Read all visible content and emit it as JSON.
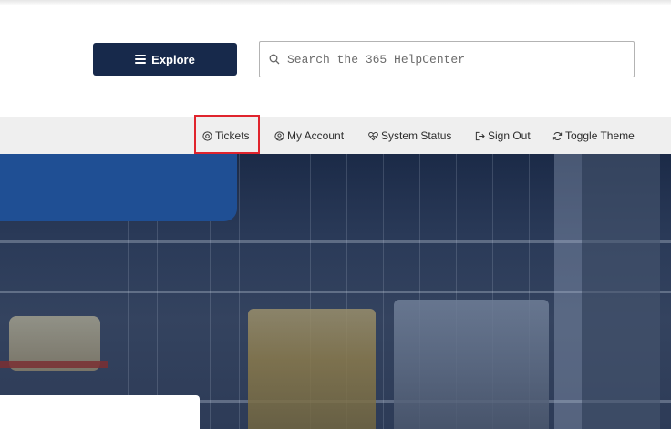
{
  "header": {
    "explore_label": "Explore",
    "search_placeholder": "Search the 365 HelpCenter"
  },
  "nav": {
    "items": [
      {
        "label": "Tickets",
        "icon": "support-icon"
      },
      {
        "label": "My Account",
        "icon": "user-circle-icon"
      },
      {
        "label": "System Status",
        "icon": "heartbeat-icon"
      },
      {
        "label": "Sign Out",
        "icon": "sign-out-icon"
      },
      {
        "label": "Toggle Theme",
        "icon": "refresh-icon"
      }
    ],
    "highlighted_item": "Tickets"
  },
  "colors": {
    "primary_navy": "#17294b",
    "banner_blue": "#1f4f94",
    "nav_background": "#efefef",
    "highlight_red": "#e0242d"
  }
}
